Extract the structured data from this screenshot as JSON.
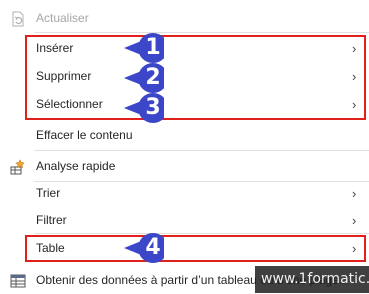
{
  "menu": {
    "items": [
      {
        "label": "Actualiser",
        "disabled": true,
        "icon": "refresh-doc-icon"
      },
      {
        "label": "Insérer",
        "submenu": true
      },
      {
        "label": "Supprimer",
        "submenu": true
      },
      {
        "label": "Sélectionner",
        "submenu": true
      },
      {
        "label": "Effacer le contenu"
      },
      {
        "label": "Analyse rapide",
        "icon": "quick-analysis-icon"
      },
      {
        "label": "Trier",
        "submenu": true
      },
      {
        "label": "Filtrer",
        "submenu": true
      },
      {
        "label": "Table",
        "submenu": true
      },
      {
        "label": "Obtenir des données à partir d’un tableau ou d’une plage...",
        "icon": "table-data-icon"
      }
    ],
    "submenu_arrow": "›"
  },
  "annotations": {
    "badges": [
      "1",
      "2",
      "3",
      "4"
    ],
    "highlight_color": "#e0201b",
    "badge_color": "#3b47c8"
  },
  "watermark": {
    "text": "www.1formatic.fr"
  }
}
